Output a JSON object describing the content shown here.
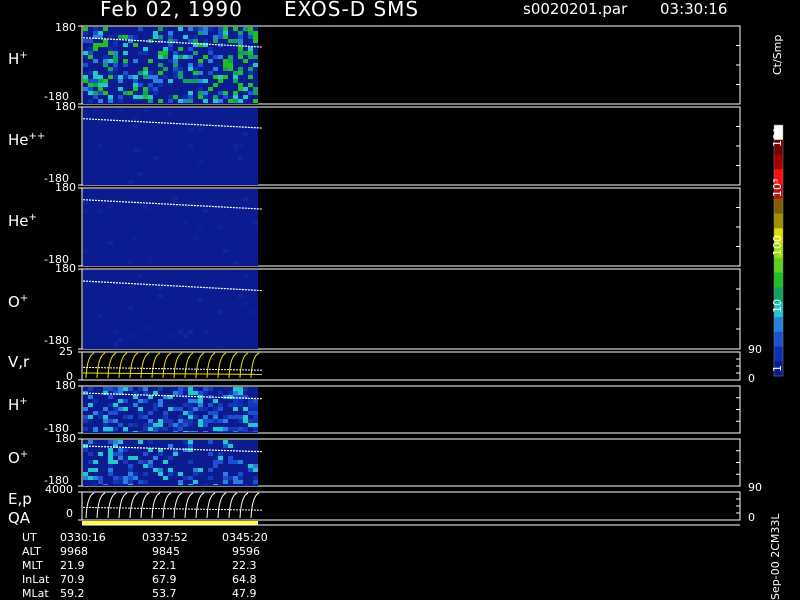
{
  "header": {
    "date": "Feb 02, 1990",
    "instrument": "EXOS-D SMS",
    "filename": "s0020201.par",
    "time": "03:30:16"
  },
  "panels": [
    {
      "label": "H",
      "sup": "+",
      "ymax": "180",
      "ymin": "-180"
    },
    {
      "label": "He",
      "sup": "++",
      "ymax": "180",
      "ymin": "-180"
    },
    {
      "label": "He",
      "sup": "+",
      "ymax": "180",
      "ymin": "-180"
    },
    {
      "label": "O",
      "sup": "+",
      "ymax": "180",
      "ymin": "-180"
    },
    {
      "label": "V,r",
      "sup": "",
      "ymax": "25",
      "ymin": "0"
    },
    {
      "label": "H",
      "sup": "+",
      "ymax": "180",
      "ymin": "-180"
    },
    {
      "label": "O",
      "sup": "+",
      "ymax": "180",
      "ymin": "-180"
    },
    {
      "label": "E,p",
      "sup": "",
      "ymax": "4000",
      "ymin": "0"
    }
  ],
  "qa_label": "QA",
  "right_axis": {
    "vr_top": "90",
    "vr_bottom": "0",
    "ep_top": "90",
    "ep_bottom": "0"
  },
  "colorbar": {
    "unit": "Ct/Smp",
    "ticks": [
      "1",
      "10",
      "100",
      "10³",
      "10⁴"
    ],
    "colors": [
      "#0a1a8c",
      "#0d2fb0",
      "#1e4fd0",
      "#2a80e0",
      "#20c8c8",
      "#10a060",
      "#20c020",
      "#60d020",
      "#a0e000",
      "#e0e000",
      "#a09000",
      "#806000",
      "#c01010",
      "#ff1010",
      "#a00000",
      "#700000",
      "#ffffff"
    ]
  },
  "footer_id": "Sep-00 2CM33L",
  "orbit_table": {
    "rows": [
      {
        "name": "UT",
        "values": [
          "0330:16",
          "0337:52",
          "0345:20"
        ]
      },
      {
        "name": "ALT",
        "values": [
          "9968",
          "9845",
          "9596"
        ]
      },
      {
        "name": "MLT",
        "values": [
          "21.9",
          "22.1",
          "22.3"
        ]
      },
      {
        "name": "InLat",
        "values": [
          "70.9",
          "67.9",
          "64.8"
        ]
      },
      {
        "name": "MLat",
        "values": [
          "59.2",
          "53.7",
          "47.9"
        ]
      }
    ]
  },
  "chart_data": {
    "type": "heatmap",
    "title": "Feb 02, 1990   EXOS-D SMS",
    "xlabel": "UT",
    "x_ticks": [
      "0330:16",
      "0337:52",
      "0345:20"
    ],
    "data_fraction_of_time_axis": 0.27,
    "panels": [
      {
        "name": "H+",
        "ylim": [
          -180,
          180
        ],
        "style": "spectrogram",
        "max_level": "100-1000"
      },
      {
        "name": "He++",
        "ylim": [
          -180,
          180
        ],
        "style": "spectrogram",
        "max_level": "1"
      },
      {
        "name": "He+",
        "ylim": [
          -180,
          180
        ],
        "style": "spectrogram",
        "max_level": "1-10"
      },
      {
        "name": "O+",
        "ylim": [
          -180,
          180
        ],
        "style": "spectrogram",
        "max_level": "1"
      },
      {
        "name": "V,r",
        "ylim": [
          0,
          25
        ],
        "y2lim": [
          0,
          90
        ],
        "style": "line"
      },
      {
        "name": "H+",
        "ylim": [
          -180,
          180
        ],
        "style": "spectrogram",
        "max_level": "10-100"
      },
      {
        "name": "O+",
        "ylim": [
          -180,
          180
        ],
        "style": "spectrogram",
        "max_level": "10"
      },
      {
        "name": "E,p",
        "ylim": [
          0,
          4000
        ],
        "y2lim": [
          0,
          90
        ],
        "style": "line"
      }
    ],
    "colorbar": {
      "label": "Ct/Smp",
      "scale": "log",
      "range": [
        1,
        10000
      ]
    }
  }
}
